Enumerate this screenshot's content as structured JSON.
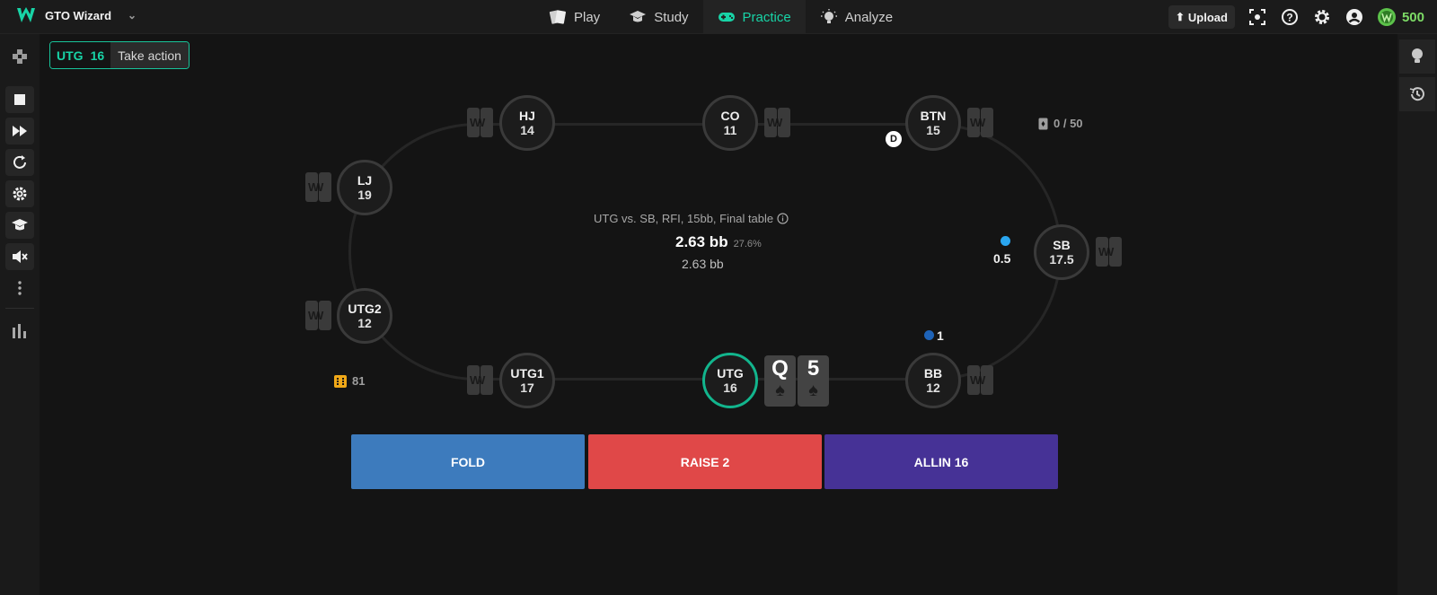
{
  "app": {
    "name": "GTO Wizard",
    "coins": "500"
  },
  "nav": [
    {
      "label": "Play",
      "icon": "cards-icon"
    },
    {
      "label": "Study",
      "icon": "graduation-cap-icon"
    },
    {
      "label": "Practice",
      "icon": "gamepad-icon",
      "active": true
    },
    {
      "label": "Analyze",
      "icon": "lightbulb-icon"
    }
  ],
  "header": {
    "upload_label": "Upload"
  },
  "status": {
    "position": "UTG",
    "stack": "16",
    "text": "Take action"
  },
  "seats": {
    "hj": {
      "pos": "HJ",
      "stack": "14"
    },
    "co": {
      "pos": "CO",
      "stack": "11"
    },
    "btn": {
      "pos": "BTN",
      "stack": "15"
    },
    "lj": {
      "pos": "LJ",
      "stack": "19"
    },
    "sb": {
      "pos": "SB",
      "stack": "17.5"
    },
    "utg2": {
      "pos": "UTG2",
      "stack": "12"
    },
    "utg1": {
      "pos": "UTG1",
      "stack": "17"
    },
    "utg": {
      "pos": "UTG",
      "stack": "16"
    },
    "bb": {
      "pos": "BB",
      "stack": "12"
    }
  },
  "cardback_mark": "W",
  "dealer_label": "D",
  "bets": {
    "sb": "0.5",
    "bb": "1"
  },
  "hand_counter": "0 / 50",
  "streak_count": "81",
  "spot_info": "UTG vs. SB, RFI, 15bb, Final table",
  "pot": {
    "main": "2.63 bb",
    "pct": "27.6%",
    "sub": "2.63 bb"
  },
  "hero_cards": [
    {
      "rank": "Q",
      "suit": "♠"
    },
    {
      "rank": "5",
      "suit": "♠"
    }
  ],
  "actions": [
    {
      "label": "FOLD",
      "color": "#3d7bbd"
    },
    {
      "label": "RAISE 2",
      "color": "#e04848"
    },
    {
      "label": "ALLIN 16",
      "color": "#463296"
    }
  ],
  "colors": {
    "accent": "#18d4a7",
    "sb_chip": "#2aa6f0",
    "bb_chip": "#1e63b8",
    "streak": "#f0a818"
  }
}
